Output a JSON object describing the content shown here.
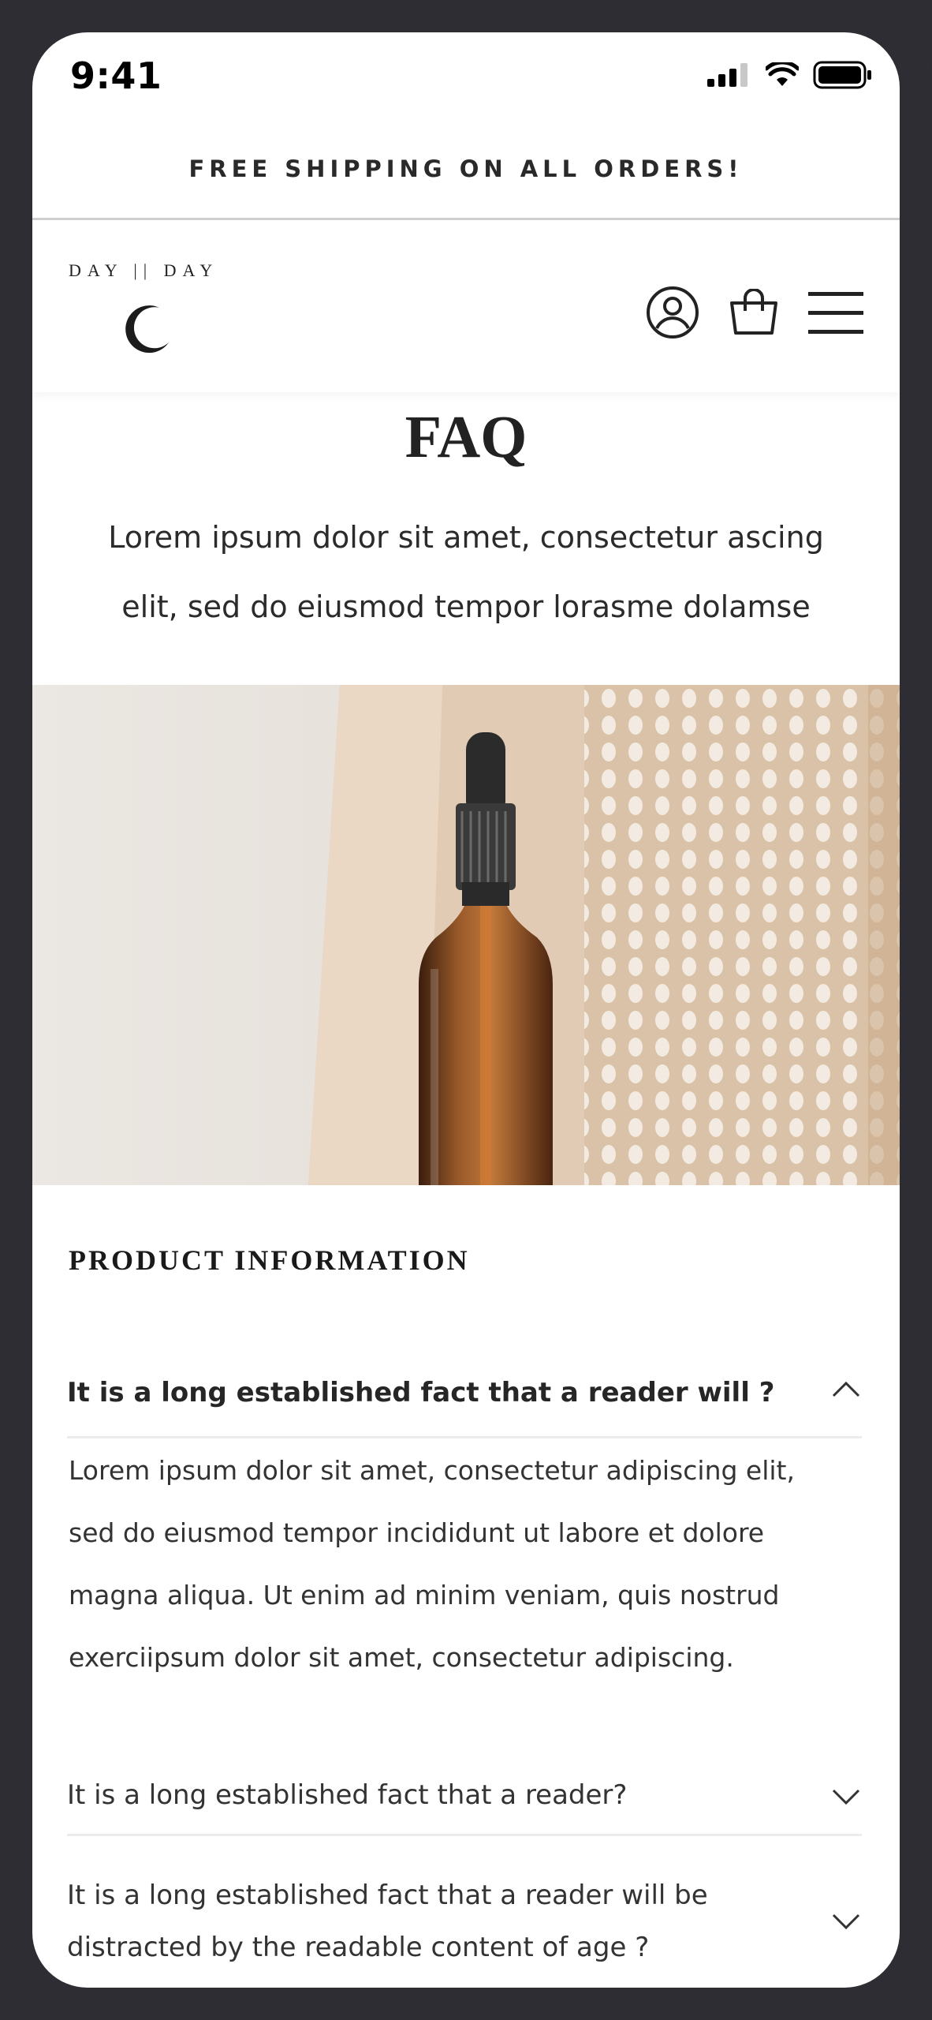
{
  "status_bar": {
    "time": "9:41"
  },
  "promo": {
    "text": "FREE SHIPPING ON ALL ORDERS!"
  },
  "header": {
    "logo_text": "DAY || DAY"
  },
  "intro": {
    "title": "FAQ",
    "text_line1": "Lorem ipsum dolor sit amet, consectetur ascing",
    "text_line2": "elit, sed do eiusmod tempor lorasme dolamse"
  },
  "faq_section": {
    "title": "PRODUCT INFORMATION",
    "items": [
      {
        "question": "It is a long established fact that a reader will ?",
        "expanded": true,
        "answer_lines": [
          "Lorem ipsum dolor sit amet, consectetur adipiscing elit,",
          "sed do eiusmod tempor incididunt ut labore et dolore",
          "magna aliqua. Ut enim ad minim veniam, quis nostrud",
          "exerciipsum dolor sit amet, consectetur adipiscing."
        ]
      },
      {
        "question": "It is a long established fact that a reader?",
        "expanded": false
      },
      {
        "question_line1": "It is a long established fact that a reader will be",
        "question_line2": "distracted by the readable content of age ?",
        "expanded": false
      }
    ]
  },
  "colors": {
    "frame": "#2e2d33",
    "text": "#262626",
    "divider": "#ececec",
    "bottle": "#8a4a1e"
  }
}
